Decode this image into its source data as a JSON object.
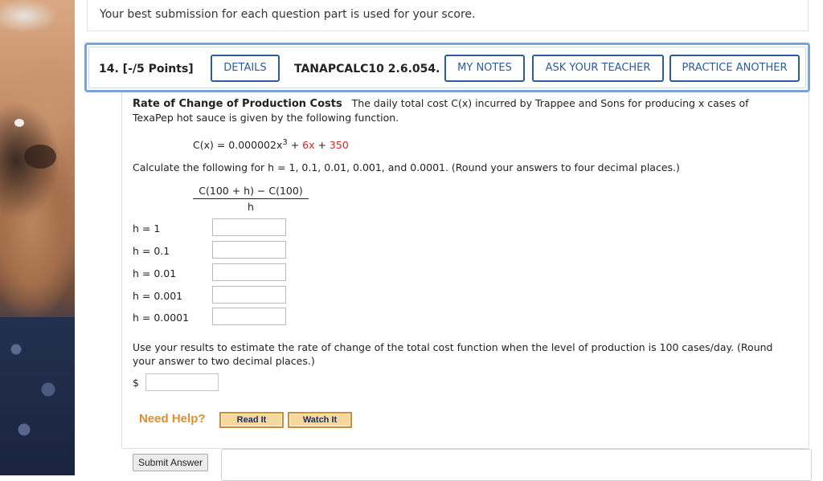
{
  "top_notice": "Your best submission for each question part is used for your score.",
  "question": {
    "number_label": "14.  [-/5 Points]",
    "details_label": "DETAILS",
    "code": "TANAPCALC10 2.6.054.",
    "my_notes_label": "MY NOTES",
    "ask_teacher_label": "ASK YOUR TEACHER",
    "practice_another_label": "PRACTICE ANOTHER"
  },
  "problem": {
    "title": "Rate of Change of Production Costs",
    "intro_1": "The daily total cost C(x) incurred by Trappee and Sons for producing x cases of",
    "intro_2": "TexaPep hot sauce is given by the following function.",
    "function_lhs": "C(x) = 0.000002x",
    "function_exp": "3",
    "function_plus1": " + ",
    "function_term2": "6x",
    "function_plus2": " + ",
    "function_term3": "350",
    "instruction": "Calculate the following for h = 1, 0.1, 0.01, 0.001, and 0.0001. (Round your answers to four decimal places.)",
    "fraction_numerator": "C(100 + h) − C(100)",
    "fraction_denominator": "h",
    "h_rows": [
      "h = 1",
      "h = 0.1",
      "h = 0.01",
      "h = 0.001",
      "h = 0.0001"
    ],
    "estimate_1": "Use your results to estimate the rate of change of the total cost function when the level of production is 100 cases/day. (Round",
    "estimate_2": "your answer to two decimal places.)",
    "currency_symbol": "$"
  },
  "help": {
    "need_help_label": "Need Help?",
    "read_it_label": "Read It",
    "watch_it_label": "Watch It"
  },
  "submit_label": "Submit Answer",
  "colors": {
    "accent_blue": "#2b5c9c",
    "header_border": "#79a4d8",
    "highlight_red": "#d6261f",
    "help_orange": "#e38d2d"
  }
}
